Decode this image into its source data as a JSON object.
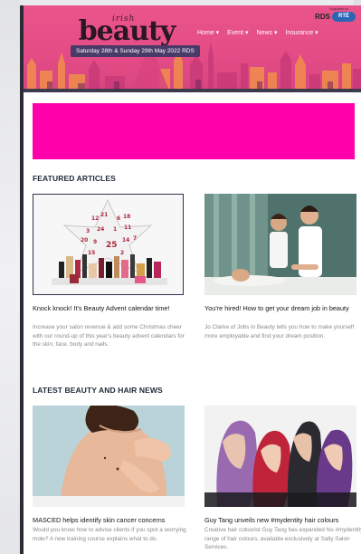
{
  "header": {
    "logo_small": "irish",
    "logo_big": "beauty",
    "dates": "Saturday 28th & Sunday 29th May 2022 RDS",
    "nav": [
      "Home ▾",
      "Event ▾",
      "News ▾",
      "Insurance ▾"
    ],
    "partner_logo": "RDS",
    "partner_badge": "RTÉ",
    "partner_tiny": "Supported by"
  },
  "colors": {
    "hero": "#e44c86",
    "banner": "#ff00aa",
    "section_title": "#1f2a3a"
  },
  "featured": {
    "title": "FEATURED ARTICLES",
    "articles": [
      {
        "title": "Knock knock! It's Beauty Advent calendar time!",
        "description": "Increase your salon revenue & add some Christmas cheer with our round-up of this year's beauty advent calendars for the skin, face, body and nails.",
        "image": "advent-calendar-image"
      },
      {
        "title": "You're hired! How to get your dream job in beauty",
        "description": "Jo Clarke of Jobs in Beauty tells you how to make yourself more employable and find your dream position.",
        "image": "spa-treatment-image"
      }
    ]
  },
  "news": {
    "title": "LATEST BEAUTY AND HAIR NEWS",
    "articles": [
      {
        "title": "MASCED helps identify skin cancer concerns",
        "description": "Would you know how to advise clients if you spot a worrying mole? A new training course explains what to do.",
        "image": "skin-check-image"
      },
      {
        "title": "Guy Tang unveils new #mydentity hair colours",
        "description": "Creative hair colourist Guy Tang has expanded his #mydentity range of hair colours, available exclusively at Sally Salon Services.",
        "image": "hair-colours-image"
      }
    ]
  }
}
